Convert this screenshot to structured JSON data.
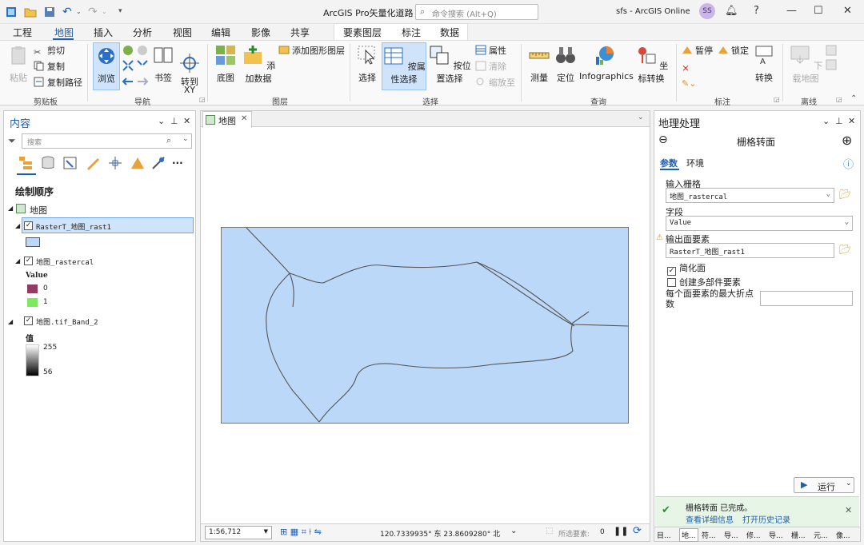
{
  "titlebar": {
    "title": "ArcGIS Pro矢量化道路",
    "search_placeholder": "命令搜索 (Alt+Q)",
    "user": "sfs - ArcGIS Online",
    "avatar_initials": "SS"
  },
  "ribbon_tabs": [
    "工程",
    "地图",
    "插入",
    "分析",
    "视图",
    "编辑",
    "影像",
    "共享"
  ],
  "context_tabs": [
    "要素图层",
    "标注",
    "数据"
  ],
  "ribbon": {
    "clipboard": {
      "paste": "粘贴",
      "cut": "剪切",
      "copy": "复制",
      "copy_path": "复制路径",
      "label": "剪贴板"
    },
    "navigate": {
      "explore": "浏览",
      "bookmarks": "书签",
      "goto": "转到\nXY",
      "label": "导航"
    },
    "layer": {
      "basemap": "底图",
      "add_data": "添加数据",
      "add_graphics": "添加图形图层",
      "label": "图层"
    },
    "selection": {
      "select": "选择",
      "by_attr": "按属性选择",
      "by_loc": "按位置选择",
      "attributes": "属性",
      "clear": "清除",
      "zoom_to": "缩放至",
      "label": "选择"
    },
    "inquiry": {
      "measure": "测量",
      "locate": "定位",
      "infographics": "Infographics",
      "convert_coords": "坐标转换",
      "label": "查询"
    },
    "labeling": {
      "pause": "暂停",
      "lock": "锁定",
      "convert": "转换",
      "label": "标注"
    },
    "offline": {
      "download": "下载地图",
      "label": "离线"
    }
  },
  "contents": {
    "title": "内容",
    "search_placeholder": "搜索",
    "drawing_order": "绘制顺序",
    "map_name": "地图",
    "layers": [
      {
        "name": "RasterT_地图_rast1",
        "checked": true
      },
      {
        "name": "地图_rastercal",
        "checked": true,
        "legend_title": "Value",
        "classes": [
          {
            "label": "0",
            "color": "#8f3b62"
          },
          {
            "label": "1",
            "color": "#7ee85e"
          }
        ]
      },
      {
        "name": "地图.tif_Band_2",
        "checked": true,
        "legend_title": "值",
        "high": "255",
        "low": "56"
      }
    ]
  },
  "map": {
    "tab_label": "地图",
    "scale": "1:56,712",
    "coordinates": "120.7339935° 东 23.8609280° 北",
    "selected_label": "所选要素:",
    "selected_count": "0"
  },
  "geoprocessing": {
    "title": "地理处理",
    "tool_name": "栅格转面",
    "tabs": [
      "参数",
      "环境"
    ],
    "input_raster_label": "输入栅格",
    "input_raster_value": "地图_rastercal",
    "field_label": "字段",
    "field_value": "Value",
    "output_label": "输出面要素",
    "output_value": "RasterT_地图_rast1",
    "simplify_label": "简化面",
    "simplify_checked": true,
    "multipart_label": "创建多部件要素",
    "multipart_checked": false,
    "max_vertices_label": "每个面要素的最大折点数",
    "run_label": "运行",
    "status_message": "栅格转面 已完成。",
    "details_link": "查看详细信息",
    "history_link": "打开历史记录",
    "bottom_tabs": [
      "目...",
      "地...",
      "符...",
      "导...",
      "修...",
      "导...",
      "栅...",
      "元...",
      "像..."
    ]
  }
}
